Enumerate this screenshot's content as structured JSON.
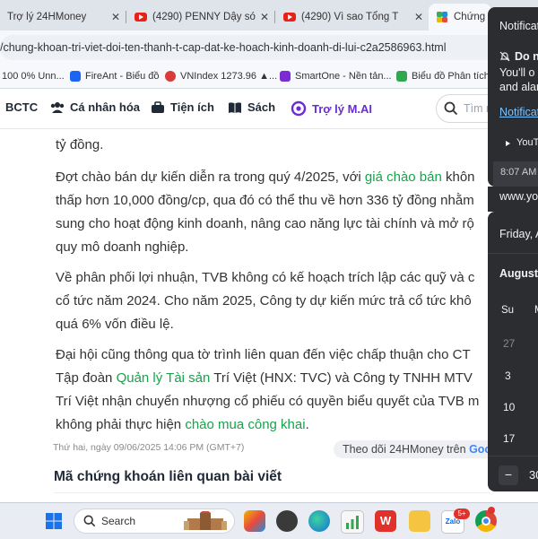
{
  "browser": {
    "tabs": [
      {
        "label": "Trợ lý 24HMoney",
        "icon": "none"
      },
      {
        "label": "(4290) PENNY Dậy só",
        "icon": "youtube-icon"
      },
      {
        "label": "(4290) Vì sao Tổng T",
        "icon": "youtube-icon"
      },
      {
        "label": "Chứng k",
        "icon": "site-icon"
      }
    ],
    "url": "/chung-khoan-tri-viet-doi-ten-thanh-t-cap-dat-ke-hoach-kinh-doanh-di-lui-c2a2586963.html",
    "bookmarks": [
      {
        "label": "100 0% Unn...",
        "color": "#3c6fd1"
      },
      {
        "label": "FireAnt - Biểu đồ",
        "color": "#1c64f2"
      },
      {
        "label": "VNIndex 1273.96 ▲...",
        "color": "#d93a3a"
      },
      {
        "label": "SmartOne - Nền tản...",
        "color": "#7a2bd6"
      },
      {
        "label": "Biểu đồ Phân tích k",
        "color": "#2fa84f"
      }
    ]
  },
  "nav": {
    "items": [
      "BCTC",
      "Cá nhân hóa",
      "Tiện ích",
      "Sách",
      "Trợ lý M.AI"
    ],
    "search_placeholder": "Tìm m"
  },
  "article": {
    "p0_line1": "tỷ đồng.",
    "p1": {
      "l1a": "Đợt chào bán dự kiến diễn ra trong quý 4/2025, với ",
      "l1link": "giá chào bán",
      "l1b": " khôn",
      "l2": "thấp hơn 10,000 đồng/cp, qua đó có thể thu về hơn 336 tỷ đồng nhằm",
      "l3": "sung cho hoạt động kinh doanh, nâng cao năng lực tài chính và mở rộ",
      "l4": "quy mô doanh nghiệp."
    },
    "p2": {
      "l1": "Về phân phối lợi nhuận, TVB không có kế hoạch trích lập các quỹ và c",
      "l2": "cổ tức năm 2024. Cho năm 2025, Công ty dự kiến mức trả cổ tức khô",
      "l3": "quá 6% vốn điều lệ."
    },
    "p3": {
      "l1": "Đại hội cũng thông qua tờ trình liên quan đến việc chấp thuận cho CT",
      "l2a": "Tập đoàn ",
      "l2link": "Quản lý Tài sản",
      "l2b": " Trí Việt (HNX: TVC) và Công ty TNHH MTV",
      "l3": "Trí Việt nhận chuyển nhượng cổ phiếu có quyền biểu quyết của TVB m",
      "l4a": "không phải thực hiện ",
      "l4link": "chào mua công khai",
      "l4b": "."
    },
    "meta": "Thứ hai, ngày 09/06/2025 14:06 PM (GMT+7)",
    "follow_label": "Theo dõi 24HMoney trên",
    "follow_brand": "Goo",
    "related_title": "Mã chứng khoán liên quan bài viết"
  },
  "notifications": {
    "header": "Notificat",
    "dnd_title": "Do n",
    "dnd_l1": "You'll o",
    "dnd_l2": "and alar",
    "settings_link": "Notificat",
    "app": "YouT",
    "time": "8:07 AM",
    "site": "www.you"
  },
  "calendar": {
    "date_header": "Friday, A",
    "month": "August",
    "weekday": "Su",
    "weekday2": "M",
    "days": [
      "27",
      "3",
      "10",
      "17"
    ],
    "minus": "−",
    "focus_minutes": "30"
  },
  "taskbar": {
    "search_label": "Search",
    "zalo_badge": "5+"
  }
}
